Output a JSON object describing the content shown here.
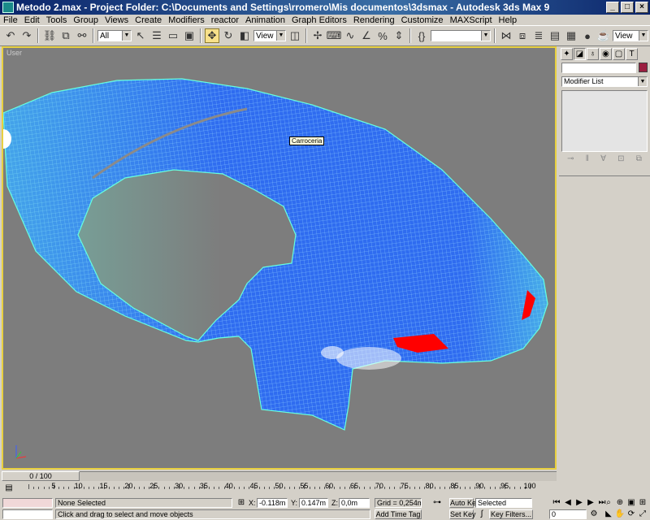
{
  "window": {
    "title": "Metodo 2.max    - Project Folder: C:\\Documents and Settings\\rromero\\Mis documentos\\3dsmax    - Autodesk 3ds Max 9",
    "min_label": "_",
    "max_label": "□",
    "close_label": "×"
  },
  "menu": [
    "File",
    "Edit",
    "Tools",
    "Group",
    "Views",
    "Create",
    "Modifiers",
    "reactor",
    "Animation",
    "Graph Editors",
    "Rendering",
    "Customize",
    "MAXScript",
    "Help"
  ],
  "toolbar": {
    "selection_filter": "All",
    "reference_coord": "View",
    "named_selection": "",
    "render_view": "View"
  },
  "viewport": {
    "label": "User",
    "tooltip": "Carroceria",
    "colors": {
      "mesh": "#2f6cf0",
      "mesh_edge": "#66ffe0",
      "taillight": "#ff0000",
      "background": "#7d7d7d"
    }
  },
  "command_panel": {
    "name_value": "",
    "object_color": "#9b1e40",
    "modifier_list": "Modifier List"
  },
  "time": {
    "slider_label": "0 / 100",
    "ticks": [
      "5",
      "10",
      "15",
      "20",
      "25",
      "30",
      "35",
      "40",
      "45",
      "50",
      "55",
      "60",
      "65",
      "70",
      "75",
      "80",
      "85",
      "90",
      "95",
      "100"
    ]
  },
  "status": {
    "selection": "None Selected",
    "prompt": "Click and drag to select and move objects",
    "x_label": "X:",
    "x_value": "-0.118m",
    "y_label": "Y:",
    "y_value": "0.147m",
    "z_label": "Z:",
    "z_value": "0,0m",
    "grid": "Grid = 0,254m",
    "add_time_tag": "Add Time Tag",
    "auto_key": "Auto Key",
    "set_key": "Set Key",
    "key_mode": "Selected",
    "key_filters": "Key Filters...",
    "frame": "0"
  }
}
